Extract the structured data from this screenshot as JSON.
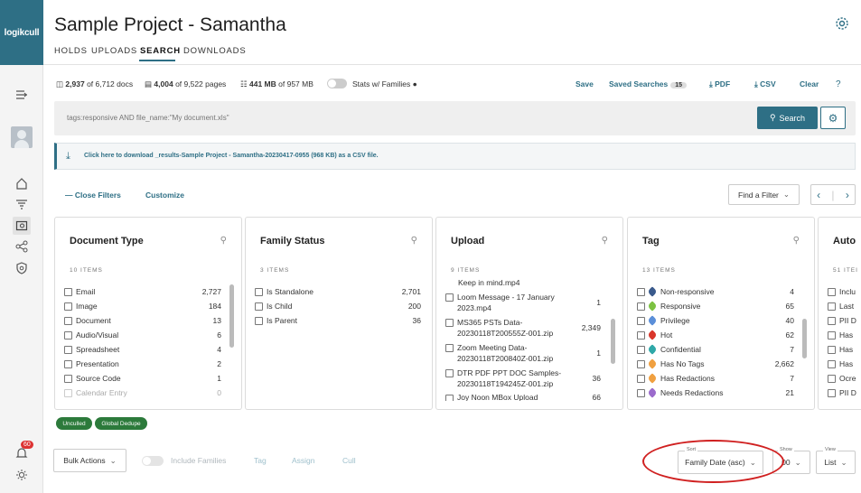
{
  "brand": {
    "logo_text": "logikcull",
    "accent": "#2e6f85"
  },
  "header": {
    "title": "Sample Project - Samantha",
    "tabs": [
      {
        "label": "HOLDS"
      },
      {
        "label": "UPLOADS"
      },
      {
        "label": "SEARCH",
        "active": true
      },
      {
        "label": "DOWNLOADS"
      }
    ]
  },
  "stats": {
    "docs_count": "2,937",
    "docs_text": "of 6,712 docs",
    "pages_count": "4,004",
    "pages_text": "of 9,522 pages",
    "size_count": "441 MB",
    "size_text": "of 957 MB",
    "stats_families_label": "Stats w/ Families"
  },
  "actions": {
    "save": "Save",
    "saved_searches": "Saved Searches",
    "saved_count": "15",
    "pdf": "PDF",
    "csv": "CSV",
    "clear": "Clear"
  },
  "search": {
    "placeholder": "tags:responsive AND file_name:\"My document.xls\"",
    "button": "Search"
  },
  "banner": {
    "text": "Click here to download _results-Sample Project - Samantha-20230417-0955 (968 KB) as a CSV file."
  },
  "filters": {
    "close": "Close Filters",
    "customize": "Customize",
    "find_filter": "Find a Filter"
  },
  "cards": {
    "doc_type": {
      "title": "Document Type",
      "count": "10 ITEMS",
      "rows": [
        {
          "label": "Email",
          "value": "2,727"
        },
        {
          "label": "Image",
          "value": "184"
        },
        {
          "label": "Document",
          "value": "13"
        },
        {
          "label": "Audio/Visual",
          "value": "6"
        },
        {
          "label": "Spreadsheet",
          "value": "4"
        },
        {
          "label": "Presentation",
          "value": "2"
        },
        {
          "label": "Source Code",
          "value": "1"
        },
        {
          "label": "Calendar Entry",
          "value": "0"
        }
      ]
    },
    "family": {
      "title": "Family Status",
      "count": "3 ITEMS",
      "rows": [
        {
          "label": "Is Standalone",
          "value": "2,701"
        },
        {
          "label": "Is Child",
          "value": "200"
        },
        {
          "label": "Is Parent",
          "value": "36"
        }
      ]
    },
    "upload": {
      "title": "Upload",
      "count": "9 ITEMS",
      "top_partial": "Keep in mind.mp4",
      "rows": [
        {
          "label1": "Loom Message - 17 January",
          "label2": "2023.mp4",
          "value": "1"
        },
        {
          "label1": "MS365 PSTs Data-",
          "label2": "20230118T200555Z-001.zip",
          "value": "2,349"
        },
        {
          "label1": "Zoom Meeting Data-",
          "label2": "20230118T200840Z-001.zip",
          "value": "1"
        },
        {
          "label1": "DTR PDF PPT DOC Samples-",
          "label2": "20230118T194245Z-001.zip",
          "value": "36"
        }
      ],
      "bottom_partial": "Joy Noon MBox Upload",
      "bottom_value": "66"
    },
    "tag": {
      "title": "Tag",
      "count": "13 ITEMS",
      "rows": [
        {
          "label": "Non-responsive",
          "value": "4",
          "color": "#3a5a8c"
        },
        {
          "label": "Responsive",
          "value": "65",
          "color": "#7cc242"
        },
        {
          "label": "Privilege",
          "value": "40",
          "color": "#5b8fd9"
        },
        {
          "label": "Hot",
          "value": "62",
          "color": "#d9362b"
        },
        {
          "label": "Confidential",
          "value": "7",
          "color": "#2fa8a8"
        },
        {
          "label": "Has No Tags",
          "value": "2,662",
          "color": "#f0a040"
        },
        {
          "label": "Has Redactions",
          "value": "7",
          "color": "#f0a040"
        },
        {
          "label": "Needs Redactions",
          "value": "21",
          "color": "#9b6bcc"
        }
      ]
    },
    "auto": {
      "title": "Auto",
      "count": "51 ITEI",
      "rows": [
        {
          "label": "Inclu"
        },
        {
          "label": "Last"
        },
        {
          "label": "PII D"
        },
        {
          "label": "Has"
        },
        {
          "label": "Has"
        },
        {
          "label": "Has"
        },
        {
          "label": "Ocre"
        },
        {
          "label": "PII D"
        }
      ]
    }
  },
  "chips": {
    "unculled": "Unculled",
    "dedupe": "Global Dedupe"
  },
  "bottom": {
    "bulk_actions": "Bulk Actions",
    "include_families": "Include Families",
    "tag": "Tag",
    "assign": "Assign",
    "cull": "Cull",
    "sort_caption": "Sort",
    "sort_value": "Family Date (asc)",
    "show_caption": "Show",
    "show_value": "00",
    "view_caption": "View",
    "view_value": "List"
  },
  "notifications": {
    "badge": "60"
  }
}
